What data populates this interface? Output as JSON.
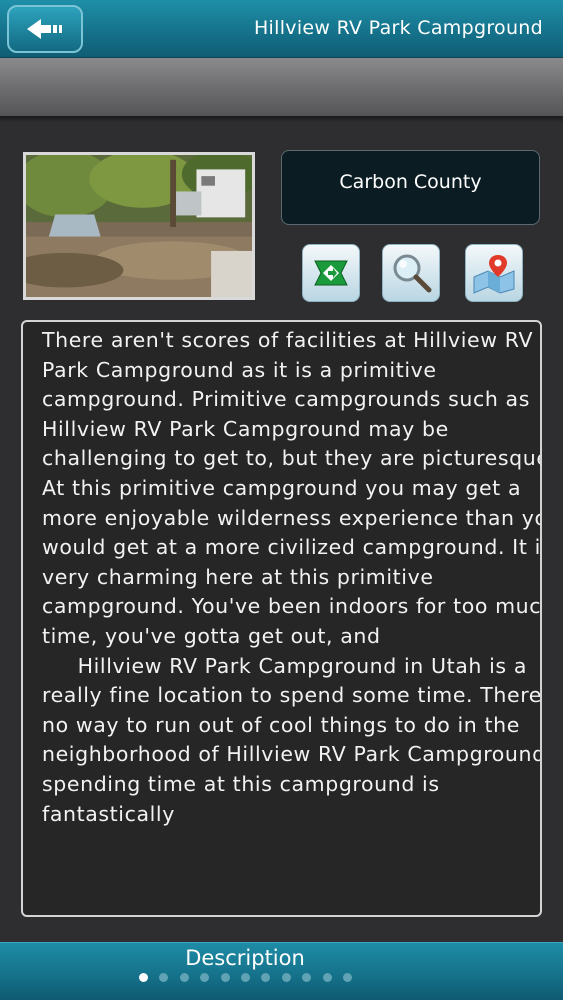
{
  "header": {
    "title": "Hillview RV Park Campground",
    "back_icon": "back-arrow-icon"
  },
  "county": {
    "label": "Carbon County"
  },
  "actions": [
    {
      "icon": "directions-sign-icon"
    },
    {
      "icon": "magnifier-icon"
    },
    {
      "icon": "map-pin-icon"
    }
  ],
  "description": {
    "text": "There aren't scores of facilities at Hillview RV Park Campground as it is a primitive campground. Primitive campgrounds such as Hillview RV Park Campground may be challenging to get to, but they are picturesque. At this primitive campground you may get a more enjoyable wilderness experience than you would get at a more civilized campground. It is very charming here at this primitive campground. You've been indoors for too much time, you've gotta get out, and\n     Hillview RV Park Campground in Utah is a really fine location to spend some time. There's no way to run out of cool things to do in the neighborhood of Hillview RV Park Campground; spending time at this campground is fantastically"
  },
  "footer": {
    "label": "Description",
    "page_count": 11,
    "active_page": 1
  },
  "colors": {
    "header": "#157089",
    "background": "#2e2e30",
    "county_box": "#0c1c23"
  }
}
